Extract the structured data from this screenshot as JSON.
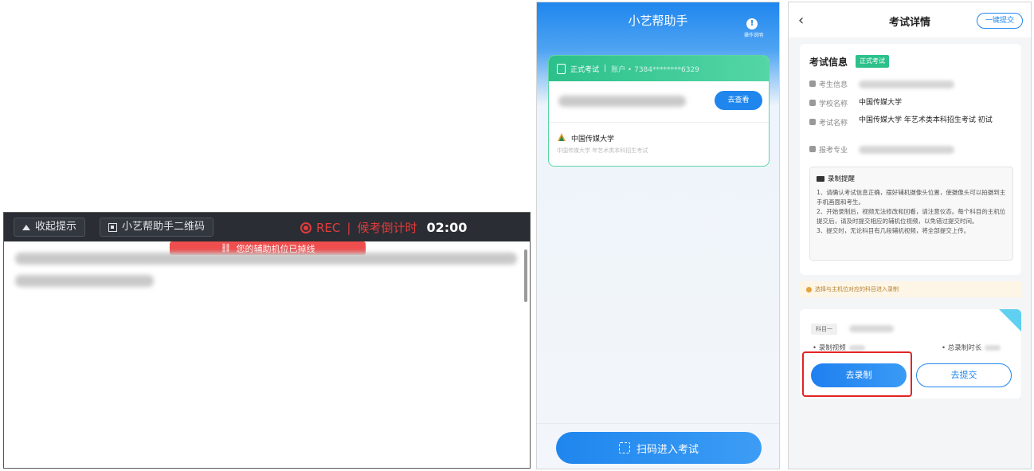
{
  "desktop": {
    "collapse_label": "收起提示",
    "qr_label": "小艺帮助手二维码",
    "rec_label": "REC",
    "countdown_label": "候考倒计时",
    "countdown_time": "02:00",
    "disconnect_alert": "您的辅助机位已掉线",
    "colors": {
      "bar": "#2a2d33",
      "alert": "#ee4e4e",
      "rec": "#e23b3b"
    }
  },
  "home": {
    "app_title": "小艺帮助手",
    "help_label": "操作说明",
    "exam_type": "正式考试",
    "account_masked": "账户 • 7384********6329",
    "go_view_label": "去查看",
    "university": "中国传媒大学",
    "university_sub": "中国传媒大学 年艺术类本科招生考试",
    "scan_label": "扫码进入考试",
    "colors": {
      "primary": "#1f86ee",
      "card_accent": "#2cc08a"
    }
  },
  "detail": {
    "page_title": "考试详情",
    "submit_all_label": "一键提交",
    "info_title": "考试信息",
    "badge": "正式考试",
    "fields": [
      {
        "label": "考生信息",
        "value": ""
      },
      {
        "label": "学校名称",
        "value": "中国传媒大学"
      },
      {
        "label": "考试名称",
        "value": "中国传媒大学 年艺术类本科招生考试 初试"
      },
      {
        "label": "报考专业",
        "value": ""
      }
    ],
    "tips_title": "录制提醒",
    "tips": [
      "1、请确认考试信息正确，摆好辅机摄像头位置，使摄像头可以拍摄到主手机画面和考生。",
      "2、开始录制后，视频无法修改和回看，请注意仪态。每个科目的主机位提交后，请及时提交相应的辅机位视频，以免错过提交时间。",
      "3、提交时，无论科目有几段辅机视频，将全部提交上传。"
    ],
    "notice": "选择与主机位对应的科目进入录制",
    "subject_tag": "科目一",
    "recorded_label": "• 录制视频",
    "duration_label": "• 总录制时长",
    "record_btn": "去录制",
    "submit_btn": "去提交",
    "colors": {
      "highlight": "#e32424",
      "notice_bg": "#fdf5e6"
    }
  }
}
